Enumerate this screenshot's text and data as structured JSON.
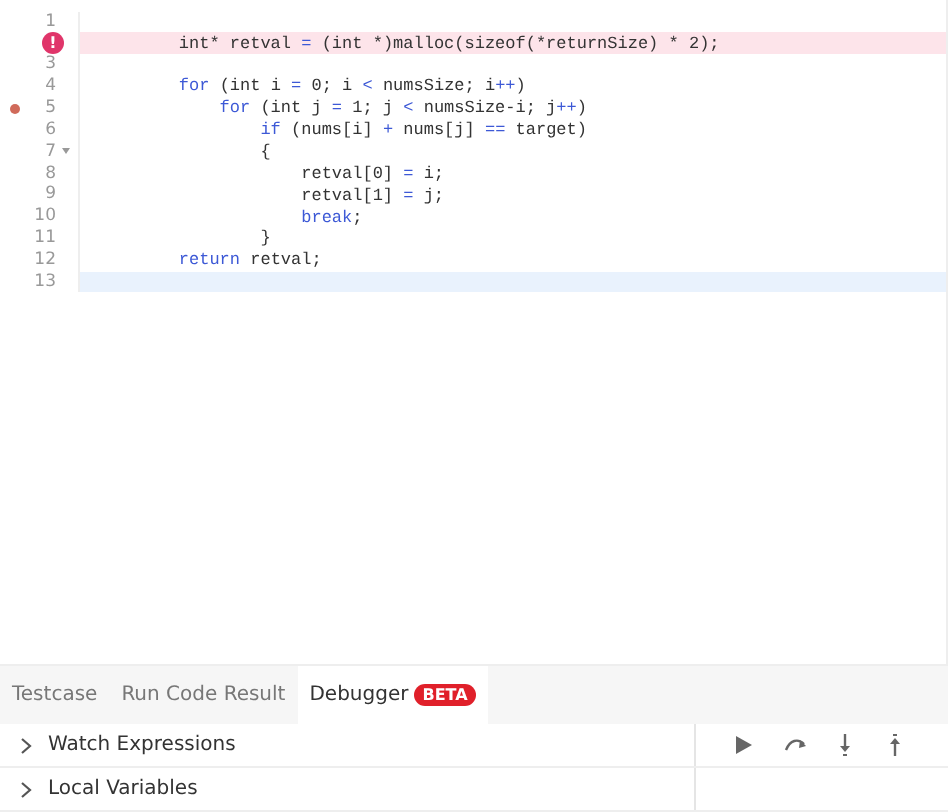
{
  "editor": {
    "lines": [
      {
        "number": "1",
        "error": false,
        "current": false
      },
      {
        "tokens": [
          {
            "kind": "plain",
            "text": "    int* retval "
          },
          {
            "kind": "op",
            "text": "="
          },
          {
            "kind": "plain",
            "text": " (int *)malloc(sizeof(*returnSize) * 2);"
          }
        ],
        "error": true,
        "current": false,
        "marker": {
          "kind": "error",
          "glyph": "!"
        }
      },
      {
        "number": "3",
        "error": false,
        "current": false
      },
      {
        "number": "4",
        "tokens": [
          {
            "kind": "keyword",
            "text": "    for"
          },
          {
            "kind": "plain",
            "text": " (int i "
          },
          {
            "kind": "op",
            "text": "="
          },
          {
            "kind": "plain",
            "text": " 0; i "
          },
          {
            "kind": "op",
            "text": "<"
          },
          {
            "kind": "plain",
            "text": " numsSize; i"
          },
          {
            "kind": "op",
            "text": "++"
          },
          {
            "kind": "plain",
            "text": ")"
          }
        ],
        "error": false,
        "current": false
      },
      {
        "number": "5",
        "tokens": [
          {
            "kind": "keyword",
            "text": "        for"
          },
          {
            "kind": "plain",
            "text": " (int j "
          },
          {
            "kind": "op",
            "text": "="
          },
          {
            "kind": "plain",
            "text": " 1; j "
          },
          {
            "kind": "op",
            "text": "<"
          },
          {
            "kind": "plain",
            "text": " numsSize-i; j"
          },
          {
            "kind": "op",
            "text": "++"
          },
          {
            "kind": "plain",
            "text": ")"
          }
        ],
        "error": false,
        "current": false,
        "marker": {
          "kind": "breakpoint"
        }
      },
      {
        "number": "6",
        "tokens": [
          {
            "kind": "keyword",
            "text": "            if"
          },
          {
            "kind": "plain",
            "text": " (nums[i] "
          },
          {
            "kind": "op",
            "text": "+"
          },
          {
            "kind": "plain",
            "text": " nums[j] "
          },
          {
            "kind": "op",
            "text": "=="
          },
          {
            "kind": "plain",
            "text": " target)"
          }
        ],
        "error": false,
        "current": false
      },
      {
        "number": "7",
        "tokens": [
          {
            "kind": "plain",
            "text": "            {"
          }
        ],
        "error": false,
        "current": false,
        "foldable": true
      },
      {
        "number": "8",
        "tokens": [
          {
            "kind": "plain",
            "text": "                retval[0] "
          },
          {
            "kind": "op",
            "text": "="
          },
          {
            "kind": "plain",
            "text": " i;"
          }
        ],
        "error": false,
        "current": false
      },
      {
        "number": "9",
        "tokens": [
          {
            "kind": "plain",
            "text": "                retval[1] "
          },
          {
            "kind": "op",
            "text": "="
          },
          {
            "kind": "plain",
            "text": " j;"
          }
        ],
        "error": false,
        "current": false
      },
      {
        "number": "10",
        "tokens": [
          {
            "kind": "keyword",
            "text": "                break"
          },
          {
            "kind": "plain",
            "text": ";"
          }
        ],
        "error": false,
        "current": false
      },
      {
        "number": "11",
        "tokens": [
          {
            "kind": "plain",
            "text": "            }"
          }
        ],
        "error": false,
        "current": false
      },
      {
        "number": "12",
        "tokens": [
          {
            "kind": "keyword",
            "text": "    return"
          },
          {
            "kind": "plain",
            "text": " retval;"
          }
        ],
        "error": false,
        "current": false
      },
      {
        "number": "13",
        "error": false,
        "current": true
      }
    ]
  },
  "tabs": [
    {
      "label": "Testcase",
      "selected": false
    },
    {
      "label": "Run Code Result",
      "selected": false
    },
    {
      "label": "Debugger",
      "selected": true,
      "badge": "BETA"
    }
  ],
  "debugger": {
    "sections": [
      {
        "label": "Watch Expressions",
        "expanded": false
      },
      {
        "label": "Local Variables",
        "expanded": false
      }
    ],
    "controls": [
      {
        "kind": "continue"
      },
      {
        "kind": "step-over"
      },
      {
        "kind": "step-into"
      },
      {
        "kind": "step-out"
      }
    ]
  }
}
